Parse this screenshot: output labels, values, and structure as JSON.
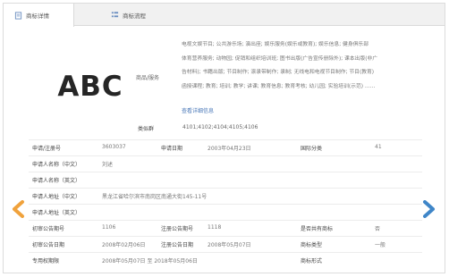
{
  "tabs": {
    "detail": "商标详情",
    "process": "商标流程"
  },
  "logo": {
    "text": "ABC"
  },
  "goods": {
    "label": "商品/服务",
    "lines": [
      "电视文娱节目; 公共游乐场; 演出座; 娱乐服务(娱乐或教育); 娱乐信息; 健身俱乐部",
      "体育营养服务; 动物园; 促销和组织培训班; 图书出版(广告宣传册除外); 课本出版(非广",
      "告材料); 书籍出版; 节目制作; 滚录带制作; 录制; 无线电和电视节目制作; 节目(教育)",
      "函授课程; 教育; 培训; 教学; 讲课; 教育信息; 教育考核; 幼儿园; 实验培训(示范) ……"
    ],
    "more_link": "查看详细信息"
  },
  "classes": {
    "label": "类似群",
    "value": "4101;4102;4104;4105;4106"
  },
  "rows": [
    {
      "l1": "申请/注册号",
      "v1": "3603037",
      "l2": "申请日期",
      "v2": "2003年04月23日",
      "l3": "国际分类",
      "v3": "41"
    },
    {
      "l1": "申请人名称（中文）",
      "v1": "刘述",
      "l2": "",
      "v2": "",
      "l3": "",
      "v3": ""
    },
    {
      "l1": "申请人名称（英文）",
      "v1": "",
      "l2": "",
      "v2": "",
      "l3": "",
      "v3": ""
    },
    {
      "l1": "申请人地址（中文）",
      "v1": "黑龙江省哈尔滨市南岗区南通大街145-11号",
      "l2": "",
      "v2": "",
      "l3": "",
      "v3": ""
    },
    {
      "l1": "申请人地址（英文）",
      "v1": "",
      "l2": "",
      "v2": "",
      "l3": "",
      "v3": ""
    },
    {
      "l1": "初审公告期号",
      "v1": "1106",
      "l2": "注册公告期号",
      "v2": "1118",
      "l3": "是否共有商标",
      "v3": "否"
    },
    {
      "l1": "初审公告日期",
      "v1": "2008年02月06日",
      "l2": "注册公告日期",
      "v2": "2008年05月07日",
      "l3": "商标类型",
      "v3": "一般"
    },
    {
      "l1": "专用权期限",
      "v1": "2008年05月07日 至 2018年05月06日",
      "l2": "",
      "v2": "",
      "l3": "商标形式",
      "v3": ""
    }
  ],
  "colors": {
    "arrow_left": "#f0a23c",
    "arrow_right": "#3f86c8"
  }
}
